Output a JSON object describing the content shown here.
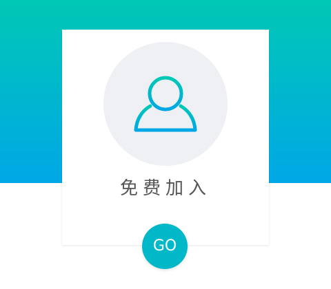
{
  "card": {
    "title": "免费加入",
    "icon": "user-icon"
  },
  "actions": {
    "go_label": "GO"
  },
  "colors": {
    "gradient_top": "#00c8b5",
    "gradient_bottom": "#00a7e6",
    "avatar_bg": "#eef0f4",
    "go_button": "#00b8c8",
    "label_text": "#555555"
  }
}
